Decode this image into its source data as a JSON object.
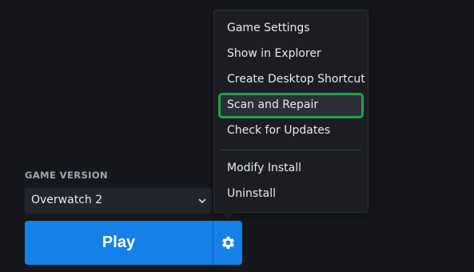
{
  "game_version": {
    "label": "GAME VERSION",
    "selected": "Overwatch 2",
    "dropdown_icon": "chevron-down-icon"
  },
  "play": {
    "label": "Play",
    "settings_icon": "gear-icon"
  },
  "context_menu": {
    "items": [
      {
        "label": "Game Settings"
      },
      {
        "label": "Show in Explorer"
      },
      {
        "label": "Create Desktop Shortcut"
      },
      {
        "label": "Scan and Repair",
        "highlighted": true
      },
      {
        "label": "Check for Updates"
      },
      {
        "label": "Modify Install"
      },
      {
        "label": "Uninstall"
      }
    ]
  },
  "colors": {
    "background": "#16171d",
    "accent_blue": "#1580e8",
    "highlight_outline": "#1fa34a",
    "menu_background": "#1b1d23"
  }
}
